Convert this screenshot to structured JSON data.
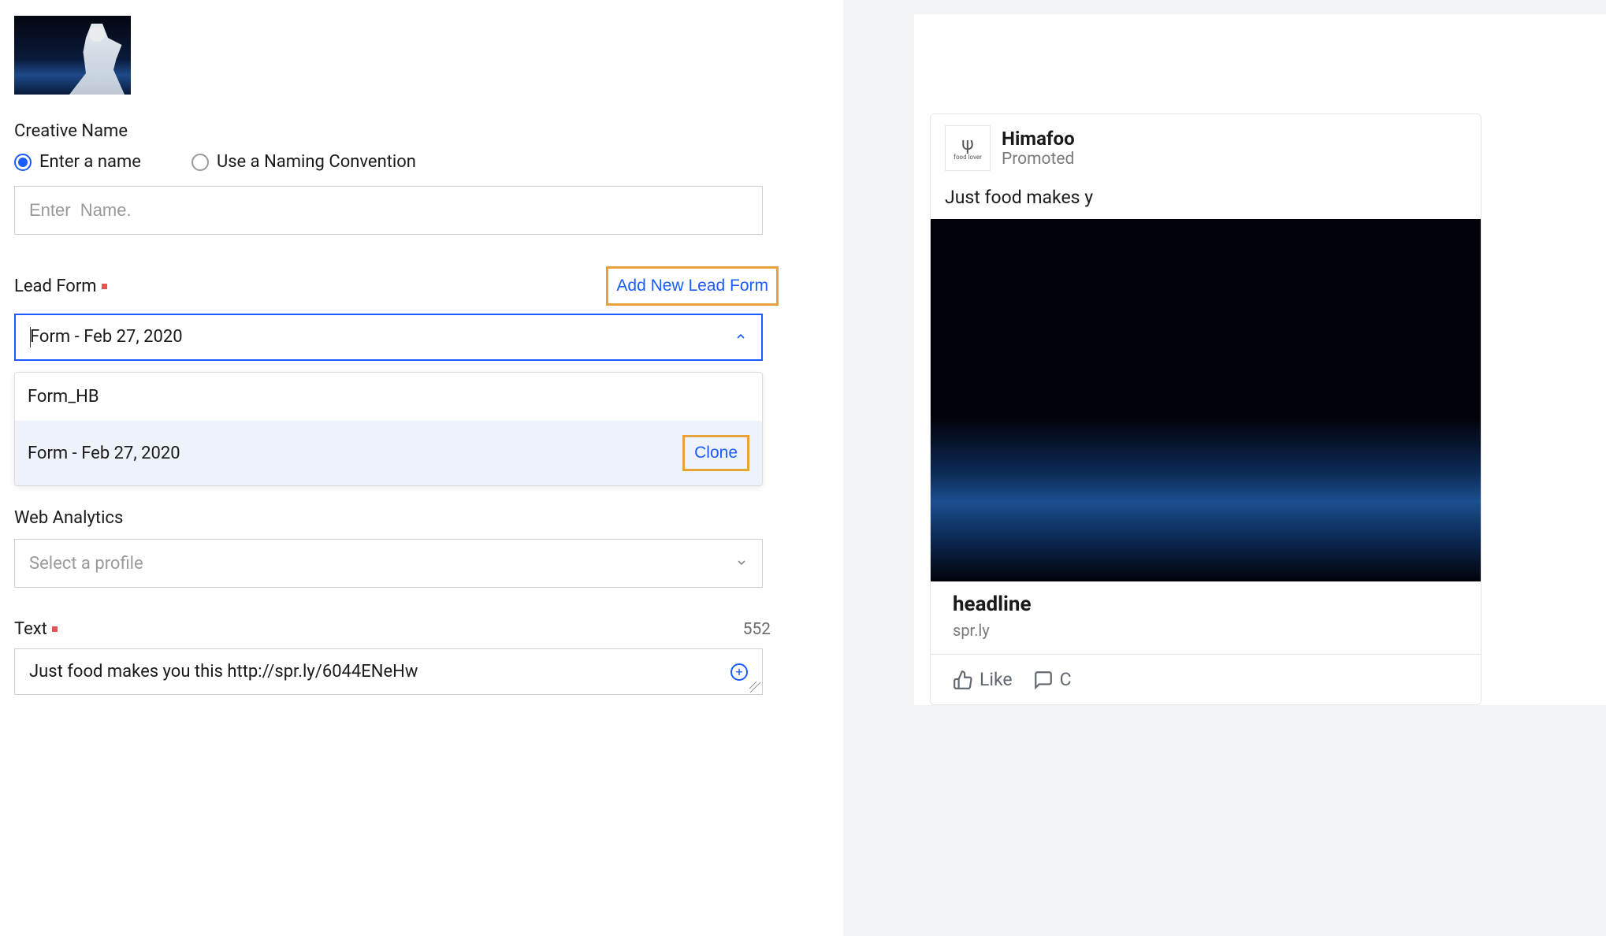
{
  "creative_name": {
    "label": "Creative Name",
    "radio_enter": "Enter a name",
    "radio_convention": "Use a Naming Convention",
    "placeholder": "Enter  Name."
  },
  "lead_form": {
    "label": "Lead Form",
    "add_new": "Add New Lead Form",
    "selected": "Form - Feb 27, 2020",
    "options": [
      {
        "label": "Form_HB"
      },
      {
        "label": "Form - Feb 27, 2020",
        "clone": "Clone"
      }
    ]
  },
  "web_analytics": {
    "label": "Web Analytics",
    "placeholder": "Select a profile"
  },
  "text_field": {
    "label": "Text",
    "count": "552",
    "value": "Just food makes you this http://spr.ly/6044ENeHw"
  },
  "preview": {
    "brand": "Himafoo",
    "promoted": "Promoted",
    "avatar_caption": "food lover",
    "post_text": "Just food makes y",
    "headline": "headline",
    "display_link": "spr.ly",
    "like": "Like",
    "comment": "C"
  }
}
